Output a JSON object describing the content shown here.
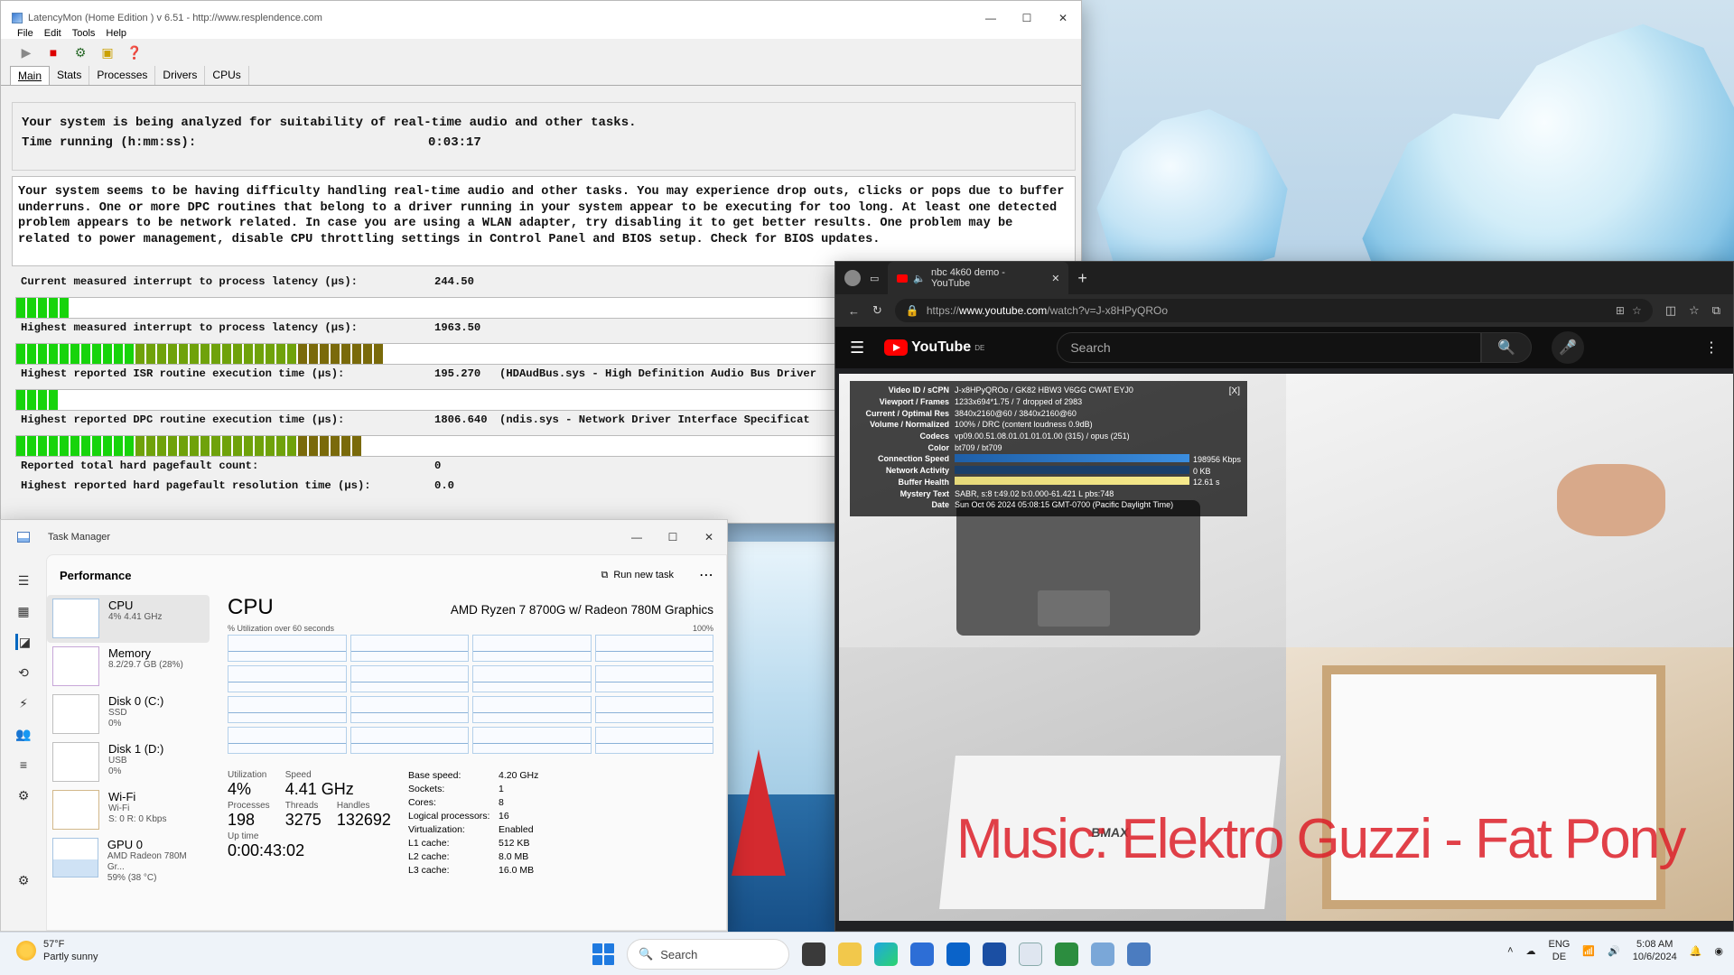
{
  "latencymon": {
    "title": "LatencyMon  (Home Edition )  v 6.51 - http://www.resplendence.com",
    "menu": [
      "File",
      "Edit",
      "Tools",
      "Help"
    ],
    "tabs": [
      "Main",
      "Stats",
      "Processes",
      "Drivers",
      "CPUs"
    ],
    "status_line": "Your system is being analyzed for suitability of real-time audio and other tasks.",
    "time_label": "Time running (h:mm:ss):",
    "time_value": "0:03:17",
    "conclusion": "Your system seems to be having difficulty handling real-time audio and other tasks. You may experience drop outs, clicks or pops due to buffer underruns. One or more DPC routines that belong to a driver running in your system appear to be executing for too long. At least one detected problem appears to be network related. In case you are using a WLAN adapter, try disabling it to get better results. One problem may be related to power management, disable CPU throttling settings in Control Panel and BIOS setup. Check for BIOS updates.",
    "metrics": [
      {
        "label": "Current measured interrupt to process latency (µs):",
        "value": "244.50",
        "desc": "",
        "segments": 5
      },
      {
        "label": "Highest measured interrupt to process latency (µs):",
        "value": "1963.50",
        "desc": "",
        "segments": 34
      },
      {
        "label": "Highest reported ISR routine execution time (µs):",
        "value": "195.270",
        "desc": "(HDAudBus.sys - High Definition Audio Bus Driver",
        "segments": 4
      },
      {
        "label": "Highest reported DPC routine execution time (µs):",
        "value": "1806.640",
        "desc": "(ndis.sys - Network Driver Interface Specificat",
        "segments": 32
      }
    ],
    "pagefault_label": "Reported total hard pagefault count:",
    "pagefault_value": "0",
    "pagefault_res_label": "Highest reported hard pagefault resolution time (µs):",
    "pagefault_res_value": "0.0"
  },
  "taskmgr": {
    "title": "Task Manager",
    "header": "Performance",
    "run_new_task": "Run new task",
    "items": [
      {
        "name": "CPU",
        "sub": "4% 4.41 GHz",
        "sub2": ""
      },
      {
        "name": "Memory",
        "sub": "8.2/29.7 GB (28%)",
        "sub2": ""
      },
      {
        "name": "Disk 0 (C:)",
        "sub": "SSD",
        "sub2": "0%"
      },
      {
        "name": "Disk 1 (D:)",
        "sub": "USB",
        "sub2": "0%"
      },
      {
        "name": "Wi-Fi",
        "sub": "Wi-Fi",
        "sub2": "S: 0 R: 0 Kbps"
      },
      {
        "name": "GPU 0",
        "sub": "AMD Radeon 780M Gr...",
        "sub2": "59% (38 °C)"
      }
    ],
    "cpu_title": "CPU",
    "cpu_model": "AMD Ryzen 7 8700G w/ Radeon 780M Graphics",
    "util_caption": "% Utilization over 60 seconds",
    "util_max": "100%",
    "utilization_label": "Utilization",
    "utilization": "4%",
    "speed_label": "Speed",
    "speed": "4.41 GHz",
    "processes_label": "Processes",
    "processes": "198",
    "threads_label": "Threads",
    "threads": "3275",
    "handles_label": "Handles",
    "handles": "132692",
    "uptime_label": "Up time",
    "uptime": "0:00:43:02",
    "specs": [
      {
        "k": "Base speed:",
        "v": "4.20 GHz"
      },
      {
        "k": "Sockets:",
        "v": "1"
      },
      {
        "k": "Cores:",
        "v": "8"
      },
      {
        "k": "Logical processors:",
        "v": "16"
      },
      {
        "k": "Virtualization:",
        "v": "Enabled"
      },
      {
        "k": "L1 cache:",
        "v": "512 KB"
      },
      {
        "k": "L2 cache:",
        "v": "8.0 MB"
      },
      {
        "k": "L3 cache:",
        "v": "16.0 MB"
      }
    ]
  },
  "browser": {
    "tab_title": "nbc 4k60 demo - YouTube",
    "url_prefix": "https://",
    "url_host": "www.youtube.com",
    "url_path": "/watch?v=J-x8HPyQROo",
    "yt_logo": "YouTube",
    "yt_region": "DE",
    "search_placeholder": "Search",
    "stats": [
      {
        "k": "Video ID / sCPN",
        "v": "J-x8HPyQROo  /  GK82 HBW3 V6GG CWAT EYJ0"
      },
      {
        "k": "Viewport / Frames",
        "v": "1233x694*1.75 / 7 dropped of 2983"
      },
      {
        "k": "Current / Optimal Res",
        "v": "3840x2160@60 / 3840x2160@60"
      },
      {
        "k": "Volume / Normalized",
        "v": "100% / DRC (content loudness 0.9dB)"
      },
      {
        "k": "Codecs",
        "v": "vp09.00.51.08.01.01.01.01.00 (315) / opus (251)"
      },
      {
        "k": "Color",
        "v": "bt709 / bt709"
      },
      {
        "k": "Connection Speed",
        "v": "198956 Kbps"
      },
      {
        "k": "Network Activity",
        "v": "0 KB"
      },
      {
        "k": "Buffer Health",
        "v": "12.61 s"
      },
      {
        "k": "Mystery Text",
        "v": "SABR, s:8 t:49.02 b:0.000-61.421 L pbs:748"
      },
      {
        "k": "Date",
        "v": "Sun Oct 06 2024 05:08:15 GMT-0700 (Pacific Daylight Time)"
      }
    ],
    "close_stats": "[X]",
    "watermark": "Music: Elektro Guzzi - Fat Pony",
    "bmax_label": "BMAX"
  },
  "taskbar": {
    "temp": "57°F",
    "weather": "Partly sunny",
    "search": "Search",
    "lang1": "ENG",
    "lang2": "DE",
    "time": "5:08 AM",
    "date": "10/6/2024"
  },
  "colors": {
    "lm_bar_low": "#17d40b",
    "lm_bar_mid": "#6fa20a",
    "lm_bar_high": "#7a6a0a",
    "tm_accent": "#0067c0",
    "yt_red": "#ff0000"
  }
}
